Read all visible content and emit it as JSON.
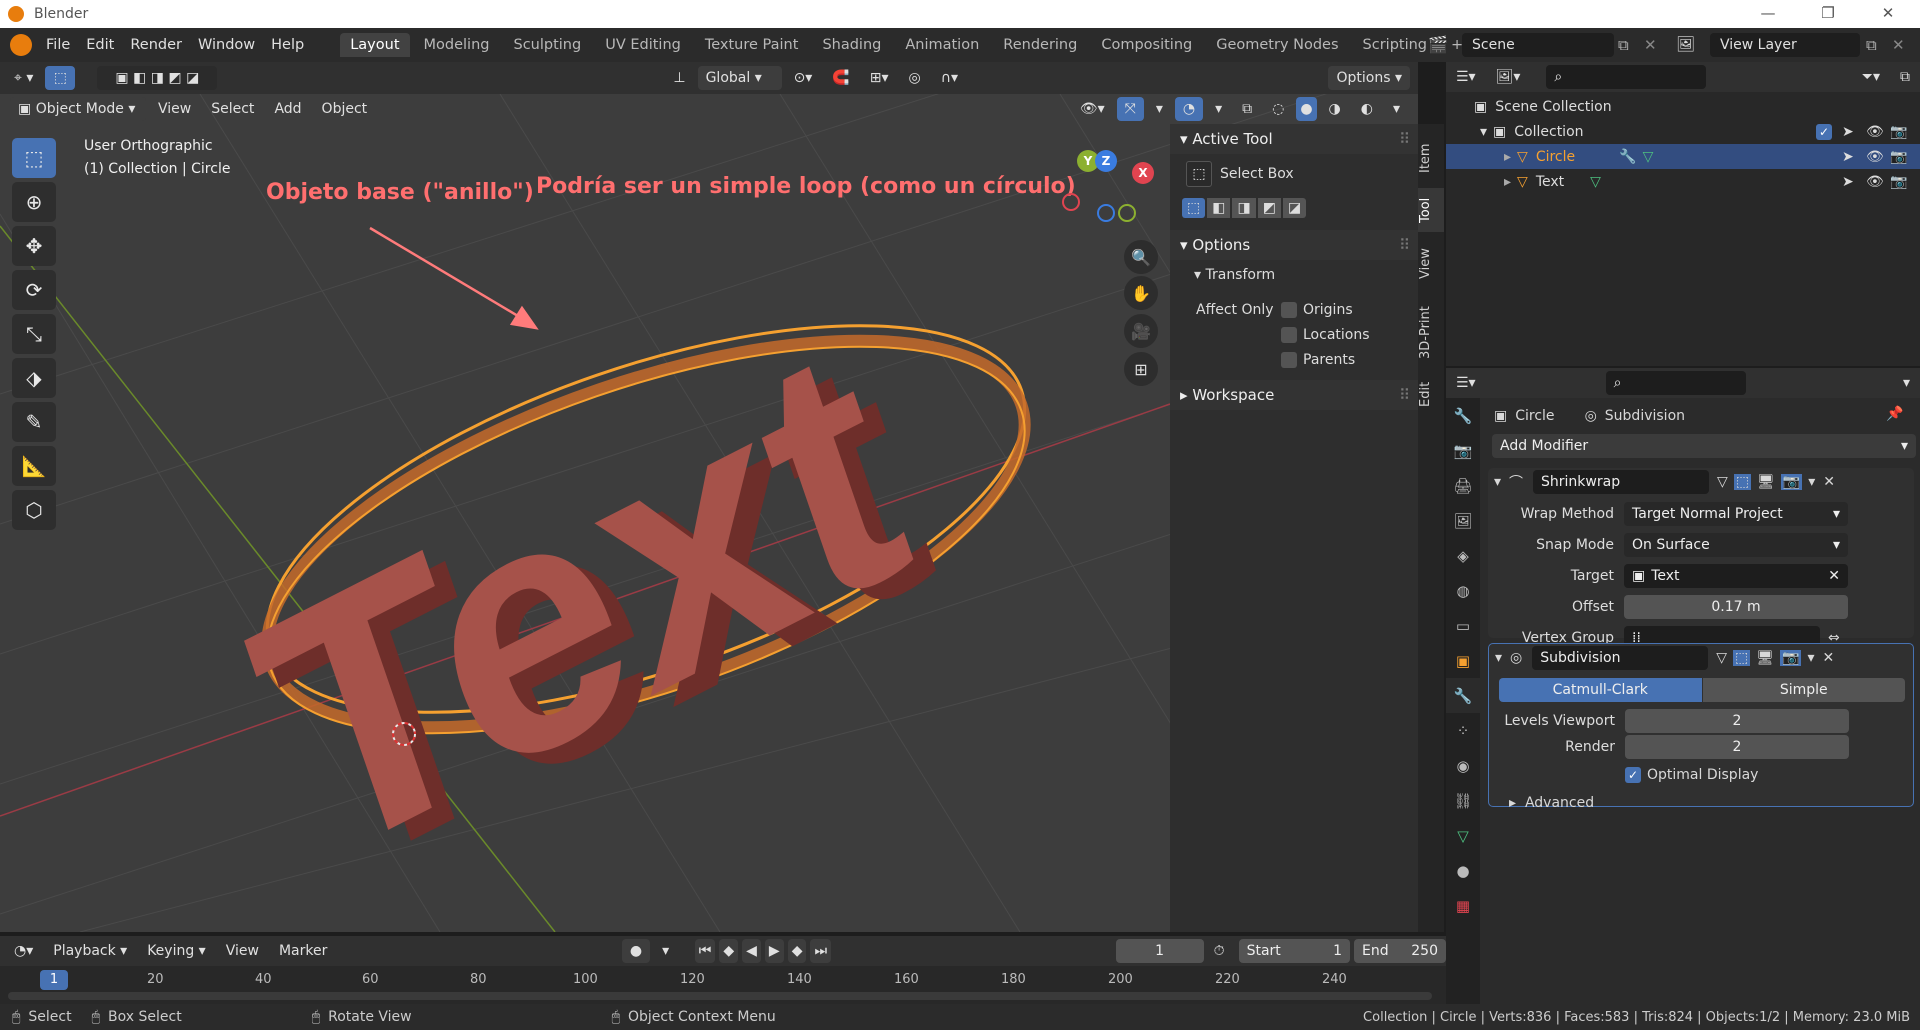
{
  "app": {
    "title": "Blender"
  },
  "menu": [
    "File",
    "Edit",
    "Render",
    "Window",
    "Help"
  ],
  "workspaces": [
    "Layout",
    "Modeling",
    "Sculpting",
    "UV Editing",
    "Texture Paint",
    "Shading",
    "Animation",
    "Rendering",
    "Compositing",
    "Geometry Nodes",
    "Scripting"
  ],
  "scene": {
    "scene_name": "Scene",
    "view_layer": "View Layer"
  },
  "viewport_header": {
    "transform_orientation": "Global",
    "options_label": "Options",
    "mode": "Object Mode",
    "view": "View",
    "select": "Select",
    "add": "Add",
    "object": "Object"
  },
  "viewport": {
    "view_name": "User Orthographic",
    "context": "(1) Collection | Circle",
    "annotation_left": "Objeto base (\"anillo\")",
    "annotation_right": "Podría ser un simple loop (como un círculo)",
    "text_object": "Text"
  },
  "npanel": {
    "active_tool_title": "Active Tool",
    "tool_name": "Select Box",
    "options_title": "Options",
    "transform_title": "Transform",
    "affect_only": "Affect Only",
    "origins": "Origins",
    "locations": "Locations",
    "parents": "Parents",
    "workspace_title": "Workspace",
    "tabs": [
      "Item",
      "Tool",
      "View",
      "3D-Print",
      "Edit"
    ]
  },
  "outliner": {
    "scene_collection": "Scene Collection",
    "collection": "Collection",
    "items": [
      {
        "name": "Circle"
      },
      {
        "name": "Text"
      }
    ]
  },
  "properties": {
    "object_name": "Circle",
    "modifier_breadcrumb": "Subdivision",
    "add_modifier": "Add Modifier",
    "shrinkwrap": {
      "name": "Shrinkwrap",
      "wrap_method_label": "Wrap Method",
      "wrap_method": "Target Normal Project",
      "snap_mode_label": "Snap Mode",
      "snap_mode": "On Surface",
      "target_label": "Target",
      "target": "Text",
      "offset_label": "Offset",
      "offset": "0.17 m",
      "vertex_group_label": "Vertex Group"
    },
    "subdivision": {
      "name": "Subdivision",
      "catmull": "Catmull-Clark",
      "simple": "Simple",
      "levels_viewport_label": "Levels Viewport",
      "levels_viewport": "2",
      "render_label": "Render",
      "render": "2",
      "optimal_display": "Optimal Display",
      "advanced": "Advanced"
    }
  },
  "timeline": {
    "playback": "Playback",
    "keying": "Keying",
    "view": "View",
    "marker": "Marker",
    "current_frame": "1",
    "start_label": "Start",
    "start": "1",
    "end_label": "End",
    "end": "250",
    "ticks": [
      "1",
      "20",
      "40",
      "60",
      "80",
      "100",
      "120",
      "140",
      "160",
      "180",
      "200",
      "220",
      "240"
    ]
  },
  "status": {
    "select": "Select",
    "box_select": "Box Select",
    "rotate_view": "Rotate View",
    "context_menu": "Object Context Menu",
    "stats": "Collection | Circle | Verts:836 | Faces:583 | Tris:824 | Objects:1/2 | Memory: 23.0 MiB"
  },
  "colors": {
    "accent": "#4772b3",
    "selection_orange": "#f5a030",
    "text_object": "#a6524a",
    "annotation": "#ff6f6f"
  }
}
